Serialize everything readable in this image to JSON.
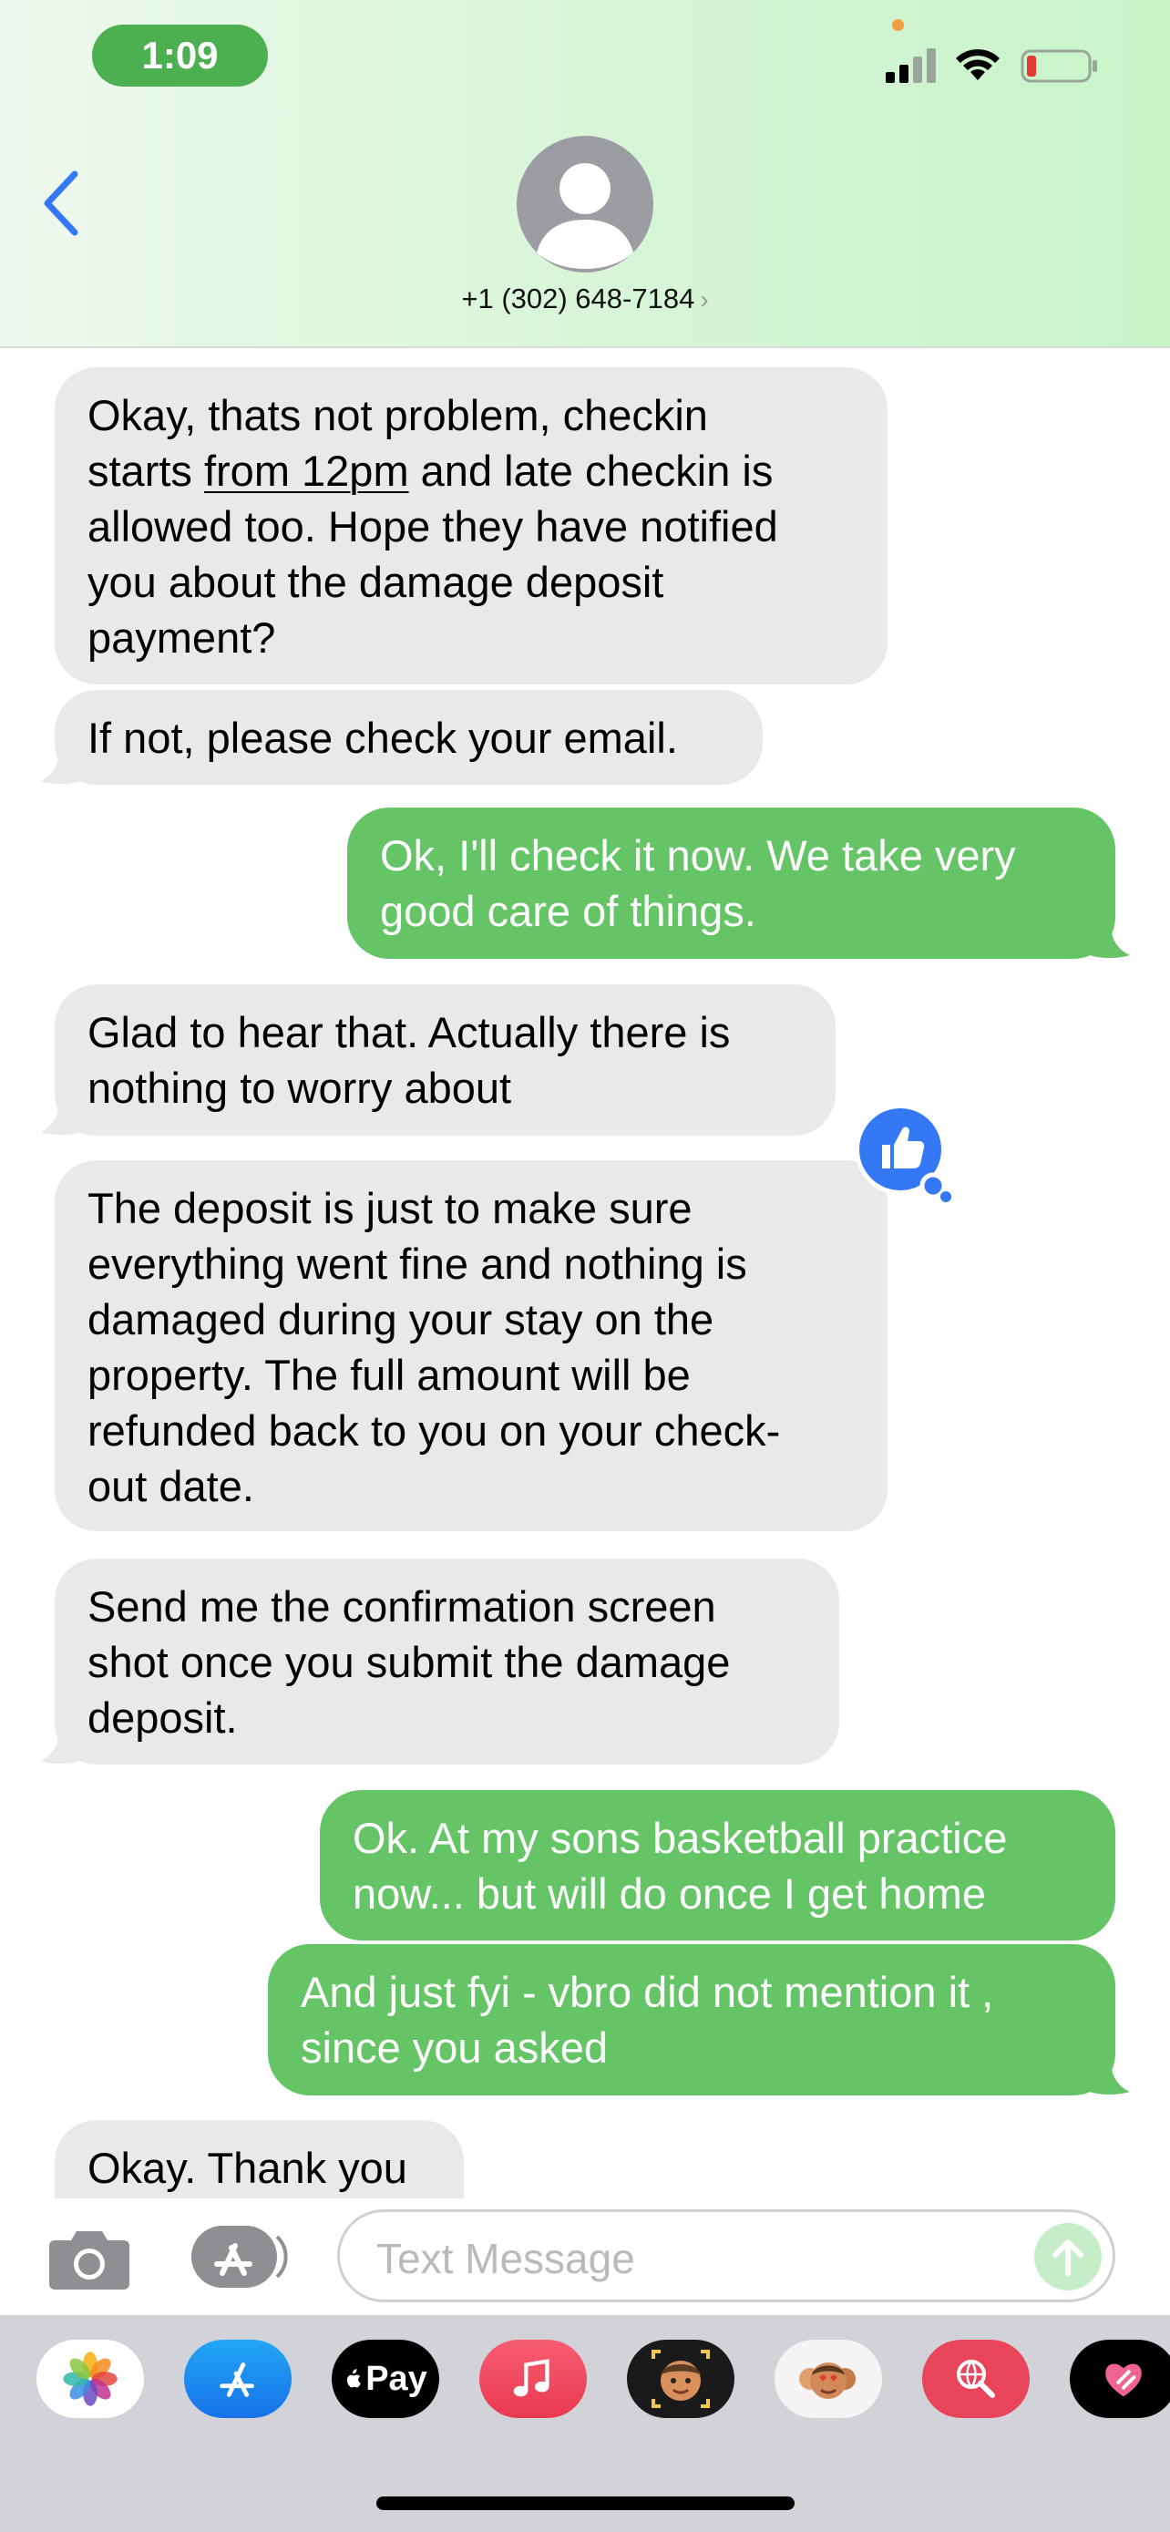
{
  "status_bar": {
    "time": "1:09",
    "battery_level": 0.1
  },
  "header": {
    "contact": "+1 (302) 648-7184",
    "chevron": "›"
  },
  "messages": [
    {
      "direction": "incoming",
      "parts": [
        "Okay, thats not problem, checkin\nstarts ",
        "from 12pm",
        " and late checkin is\nallowed too. Hope they have notified\nyou about the damage deposit\npayment?"
      ]
    },
    {
      "direction": "incoming",
      "text": "If not, please check your email."
    },
    {
      "direction": "outgoing",
      "text": "Ok, I'll check it now. We take very\ngood care of things."
    },
    {
      "direction": "incoming",
      "text": "Glad to hear that. Actually there is\nnothing to worry about",
      "reaction": "thumbs-up"
    },
    {
      "direction": "incoming",
      "text": "The deposit is just to make sure\neverything went fine and nothing is\ndamaged during your stay on the\nproperty. The full amount will be\nrefunded back to you on your check-\nout date."
    },
    {
      "direction": "incoming",
      "text": "Send me the confirmation screen\nshot once you submit the damage\ndeposit."
    },
    {
      "direction": "outgoing",
      "text": "Ok. At my sons basketball practice\nnow... but will do once I get home"
    },
    {
      "direction": "outgoing",
      "text": "And just fyi - vbro did not mention it ,\nsince you asked"
    },
    {
      "direction": "incoming",
      "text": "Okay. Thank you"
    }
  ],
  "composer": {
    "placeholder": "Text Message"
  },
  "app_drawer": [
    {
      "name": "photos-icon"
    },
    {
      "name": "app-store-icon"
    },
    {
      "name": "apple-pay-icon",
      "label": "Pay"
    },
    {
      "name": "music-icon"
    },
    {
      "name": "memoji-camera-icon"
    },
    {
      "name": "memoji-stickers-icon"
    },
    {
      "name": "web-search-icon"
    },
    {
      "name": "digital-touch-icon"
    }
  ],
  "colors": {
    "outgoing": "#65c466",
    "incoming": "#e9e9eb",
    "ios_blue": "#3478f6"
  }
}
